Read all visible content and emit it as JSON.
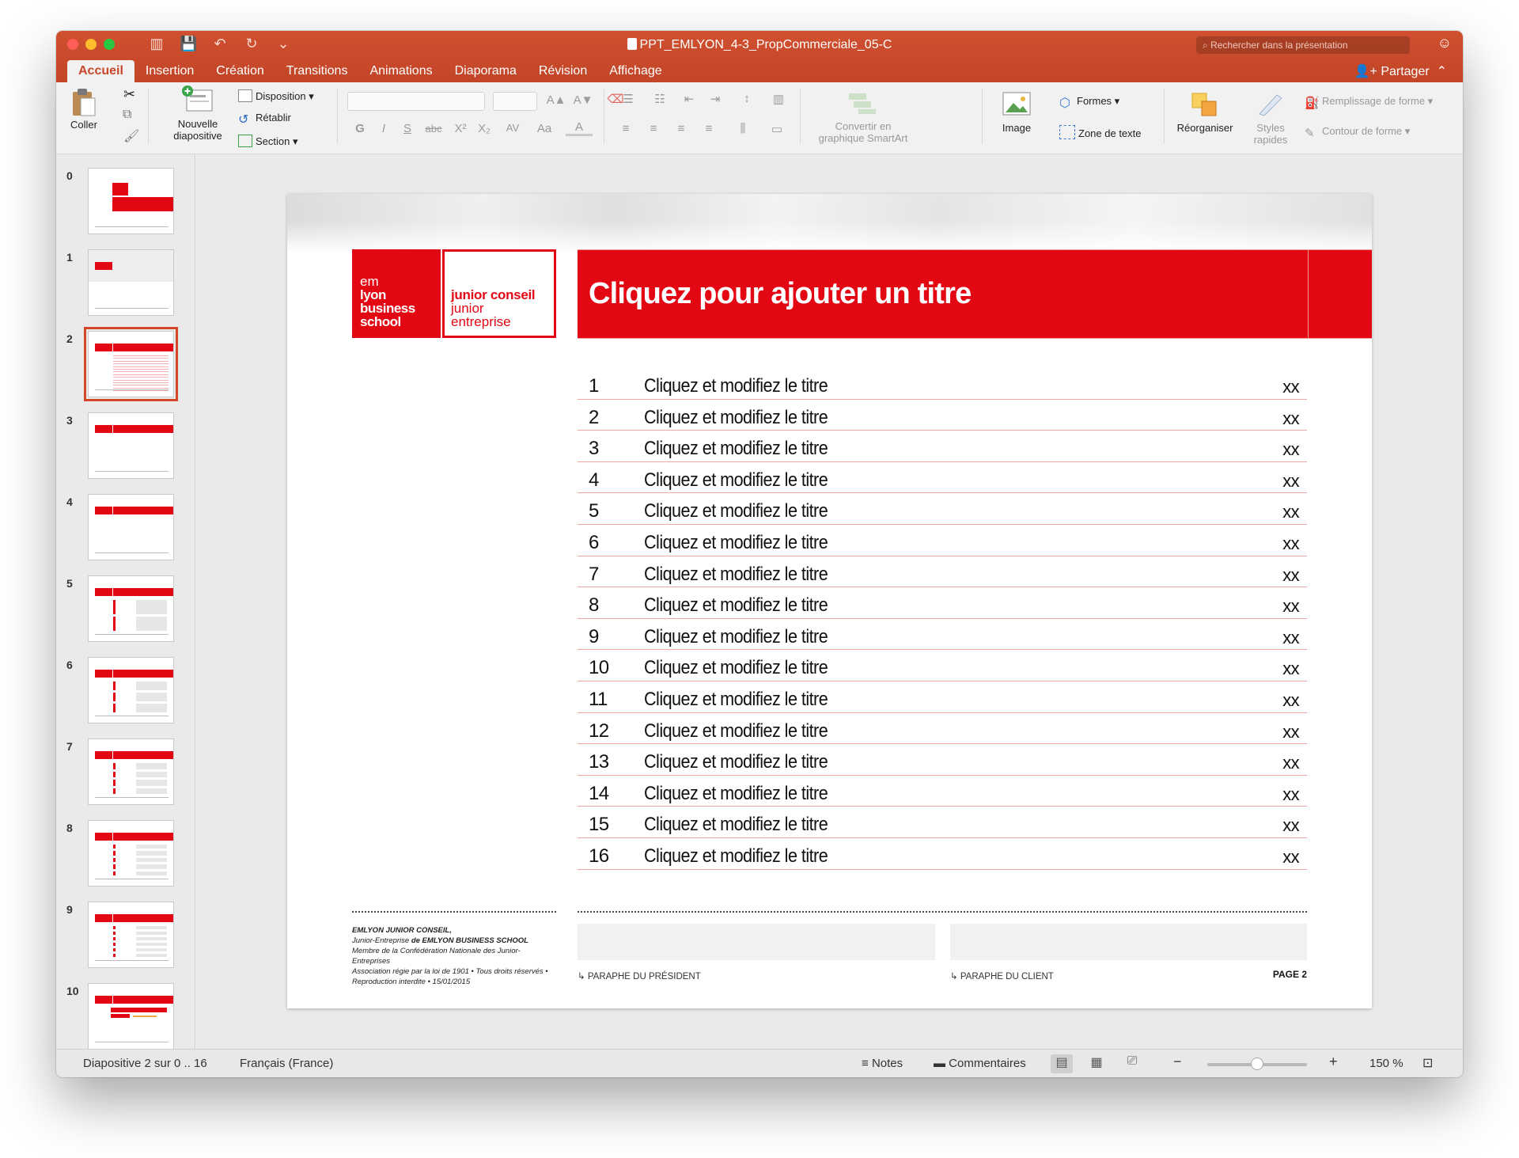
{
  "window": {
    "doc_title": "PPT_EMLYON_4-3_PropCommerciale_05-C",
    "search_placeholder": "Rechercher dans la présentation"
  },
  "tabs": [
    "Accueil",
    "Insertion",
    "Création",
    "Transitions",
    "Animations",
    "Diaporama",
    "Révision",
    "Affichage"
  ],
  "active_tab": "Accueil",
  "share_label": "Partager",
  "ribbon": {
    "paste": "Coller",
    "new_slide_line1": "Nouvelle",
    "new_slide_line2": "diapositive",
    "layout": "Disposition",
    "reset": "Rétablir",
    "section": "Section",
    "convert_line1": "Convertir en",
    "convert_line2": "graphique SmartArt",
    "image": "Image",
    "shapes": "Formes",
    "textbox": "Zone de texte",
    "arrange": "Réorganiser",
    "quick_styles_line1": "Styles",
    "quick_styles_line2": "rapides",
    "shape_fill": "Remplissage de forme",
    "shape_outline": "Contour de forme",
    "format_glyphs": {
      "bold": "G",
      "italic": "I",
      "underline": "S",
      "strike": "abc",
      "superscript": "X²",
      "subscript": "X₂",
      "spacing": "AV",
      "case": "Aa",
      "color": "A",
      "grow": "A▲",
      "shrink": "A▼"
    }
  },
  "thumbnails": [
    "0",
    "1",
    "2",
    "3",
    "4",
    "5",
    "6",
    "7",
    "8",
    "9",
    "10"
  ],
  "selected_slide": 2,
  "slide": {
    "logo_em": [
      "em",
      "lyon",
      "business",
      "school"
    ],
    "logo_jc": [
      "junior conseil",
      "junior",
      "entreprise"
    ],
    "title": "Cliquez pour ajouter un titre",
    "toc": [
      {
        "num": "1",
        "title": "Cliquez et modifiez le titre",
        "page": "xx"
      },
      {
        "num": "2",
        "title": "Cliquez et modifiez le titre",
        "page": "xx"
      },
      {
        "num": "3",
        "title": "Cliquez et modifiez le titre",
        "page": "xx"
      },
      {
        "num": "4",
        "title": "Cliquez et modifiez le titre",
        "page": "xx"
      },
      {
        "num": "5",
        "title": "Cliquez et modifiez le titre",
        "page": "xx"
      },
      {
        "num": "6",
        "title": "Cliquez et modifiez le titre",
        "page": "xx"
      },
      {
        "num": "7",
        "title": "Cliquez et modifiez le titre",
        "page": "xx"
      },
      {
        "num": "8",
        "title": "Cliquez et modifiez le titre",
        "page": "xx"
      },
      {
        "num": "9",
        "title": "Cliquez et modifiez le titre",
        "page": "xx"
      },
      {
        "num": "10",
        "title": "Cliquez et modifiez le titre",
        "page": "xx"
      },
      {
        "num": "11",
        "title": "Cliquez et modifiez le titre",
        "page": "xx"
      },
      {
        "num": "12",
        "title": "Cliquez et modifiez le titre",
        "page": "xx"
      },
      {
        "num": "13",
        "title": "Cliquez et modifiez le titre",
        "page": "xx"
      },
      {
        "num": "14",
        "title": "Cliquez et modifiez le titre",
        "page": "xx"
      },
      {
        "num": "15",
        "title": "Cliquez et modifiez le titre",
        "page": "xx"
      },
      {
        "num": "16",
        "title": "Cliquez et modifiez le titre",
        "page": "xx"
      }
    ],
    "legal": {
      "line1": "EMLYON JUNIOR CONSEIL,",
      "line2a": "Junior-Entreprise ",
      "line2b": "de EMLYON BUSINESS SCHOOL",
      "line3": "Membre de la Confédération Nationale des Junior-Entreprises",
      "line4": "Association régie par la loi de 1901 • Tous droits réservés • Reproduction interdite • 15/01/2015"
    },
    "paraphe_president": "↳ PARAPHE DU PRÉSIDENT",
    "paraphe_client": "↳ PARAPHE DU CLIENT",
    "page_label": "PAGE 2"
  },
  "status": {
    "slide_info": "Diapositive 2 sur 0 .. 16",
    "language": "Français (France)",
    "notes": "Notes",
    "comments": "Commentaires",
    "zoom_minus": "−",
    "zoom_plus": "+",
    "zoom": "150 %",
    "zoom_fraction": 0.5
  },
  "colors": {
    "accent_orange": "#c8472a",
    "brand_red": "#e30613"
  }
}
